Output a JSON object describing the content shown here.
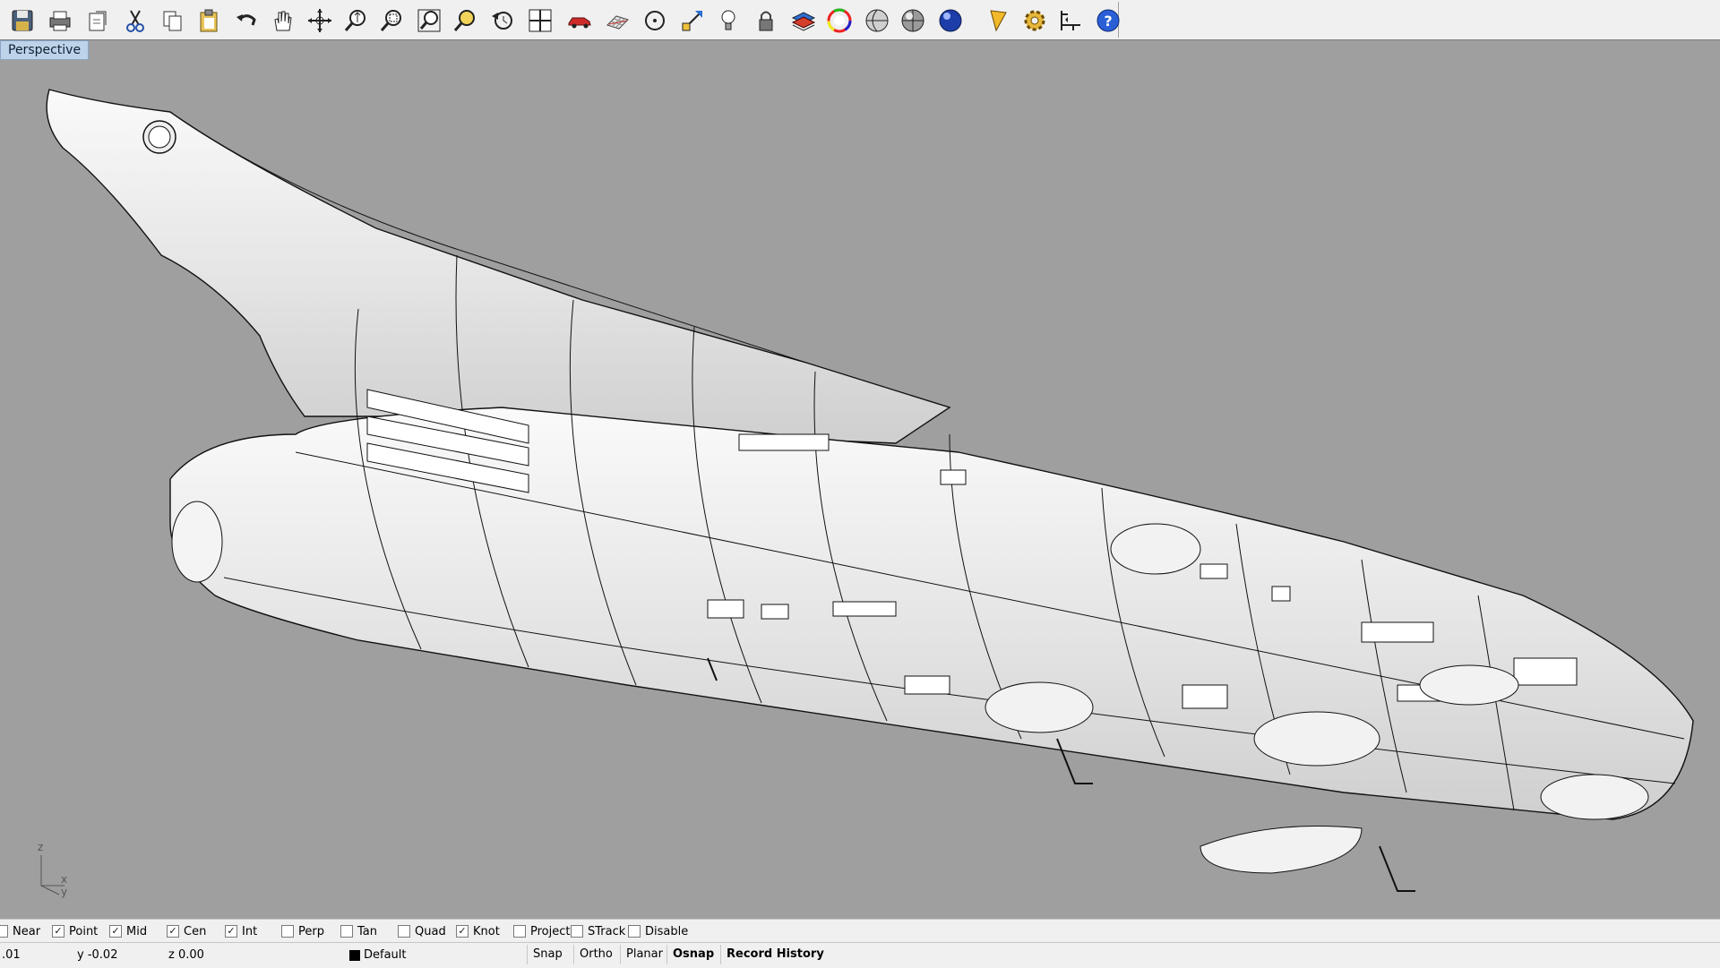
{
  "toolbar": {
    "icons": [
      "save-icon",
      "print-icon",
      "copy-clipboard-icon",
      "cut-icon",
      "copy-icon",
      "paste-icon",
      "undo-icon",
      "pan-hand-icon",
      "rotate-view-icon",
      "zoom-dynamic-icon",
      "zoom-window-icon",
      "zoom-extents-icon",
      "zoom-selected-icon",
      "undo-view-icon",
      "four-viewports-icon",
      "car-icon",
      "grid-icon",
      "circle-icon",
      "transform-icon",
      "light-bulb-icon",
      "lock-icon",
      "layer-icon",
      "color-wheel-icon",
      "wireframe-sphere-icon",
      "shaded-sphere-icon",
      "rendered-sphere-icon",
      "flag-icon",
      "gear-icon",
      "dimension-icon",
      "help-icon"
    ]
  },
  "viewport": {
    "title": "Perspective",
    "axes": {
      "z": "z",
      "x": "x",
      "y": "y"
    }
  },
  "osnap": [
    {
      "label": "Near",
      "checked": false
    },
    {
      "label": "Point",
      "checked": true
    },
    {
      "label": "Mid",
      "checked": true
    },
    {
      "label": "Cen",
      "checked": true
    },
    {
      "label": "Int",
      "checked": true
    },
    {
      "label": "Perp",
      "checked": false
    },
    {
      "label": "Tan",
      "checked": false
    },
    {
      "label": "Quad",
      "checked": false
    },
    {
      "label": "Knot",
      "checked": true
    },
    {
      "label": "Project",
      "checked": false
    },
    {
      "label": "STrack",
      "checked": false
    },
    {
      "label": "Disable",
      "checked": false
    }
  ],
  "status": {
    "x": ".01",
    "y": "y -0.02",
    "z": "z 0.00",
    "layer": "Default",
    "layer_color": "#000000",
    "snap": "Snap",
    "ortho": "Ortho",
    "planar": "Planar",
    "osnap": "Osnap",
    "record_history": "Record History"
  }
}
